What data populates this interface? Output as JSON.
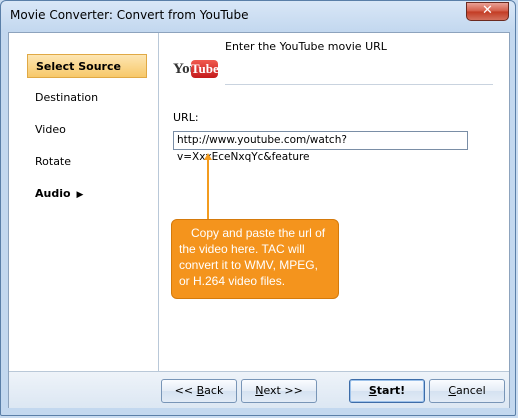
{
  "window": {
    "title": "Movie Converter:  Convert from YouTube",
    "close_symbol": "✕"
  },
  "sidebar": {
    "items": [
      {
        "label": "Select Source",
        "active": true
      },
      {
        "label": "Destination",
        "active": false
      },
      {
        "label": "Video",
        "active": false
      },
      {
        "label": "Rotate",
        "active": false
      },
      {
        "label": "Audio",
        "active": false,
        "submenu_arrow": "▶"
      }
    ]
  },
  "main": {
    "heading": "Enter the YouTube movie URL",
    "logo": {
      "you": "You",
      "tube": "Tube"
    },
    "url_label": "URL:",
    "url_value": "http://www.youtube.com/watch?v=XxxEceNxqYc&feature",
    "callout": {
      "lines": [
        "Copy and paste the url of",
        "the video here. TAC will",
        "convert it to WMV, MPEG,",
        "or H.264 video files."
      ],
      "color": "#f4941d"
    }
  },
  "buttons": {
    "back": {
      "prefix": "<< ",
      "mnemonic": "B",
      "rest": "ack"
    },
    "next": {
      "mnemonic": "N",
      "rest": "ext >>"
    },
    "start": {
      "mnemonic": "S",
      "rest": "tart!"
    },
    "cancel": {
      "mnemonic": "C",
      "rest": "ancel"
    }
  }
}
